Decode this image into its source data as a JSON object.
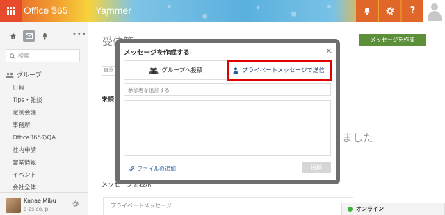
{
  "topbar": {
    "app_title": "Office 365",
    "app_name": "Yammer",
    "help_glyph": "?",
    "icons": [
      "waffle-icon",
      "bell-icon",
      "gear-icon",
      "help-icon",
      "user-icon"
    ],
    "accent": "#e74b2b"
  },
  "sidebar": {
    "search_placeholder": "検索",
    "group_heading": "グループ",
    "items": [
      "日報",
      "Tips・雑談",
      "定例会議",
      "事務所",
      "Office365のQA",
      "社内申請",
      "営業情報",
      "イベント",
      "会社全体"
    ],
    "user": {
      "name": "Kanae Mibu",
      "domain": "a-zs.co.jp"
    }
  },
  "main": {
    "title": "受信箱",
    "compose_label": "メッセージを作成",
    "filter_text": "自分",
    "unread_heading": "未読メ",
    "background_text": "ました",
    "show_messages": "メッセージを表示",
    "private_message": "プライベートメッセージ",
    "online_label": "オンライン",
    "compose_color": "#5b8f3a"
  },
  "modal": {
    "title": "メッセージを作成する",
    "close_glyph": "×",
    "tab_group": "グループへ投稿",
    "tab_private": "プライベートメッセージで送信",
    "recipients_placeholder": "参加者を追加する",
    "attach_label": "ファイルの追加",
    "post_label": "投稿",
    "highlight_color": "#e00000"
  }
}
